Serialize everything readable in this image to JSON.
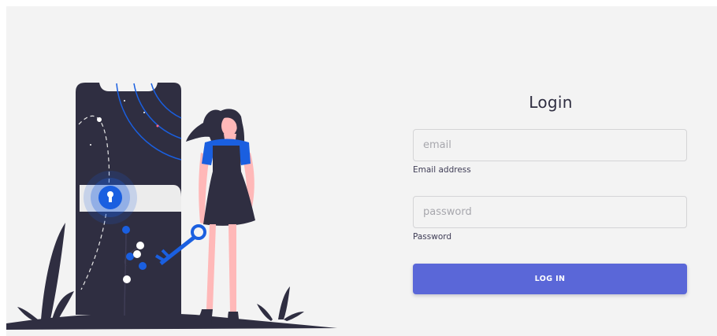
{
  "login": {
    "title": "Login",
    "email": {
      "placeholder": "email",
      "value": "",
      "help_text": "Email address"
    },
    "password": {
      "placeholder": "password",
      "value": "",
      "help_text": "Password"
    },
    "submit_label": "LOG IN"
  },
  "colors": {
    "accent": "#5a67d8",
    "illustration_blue": "#1a5fe0",
    "dark": "#2f2e41",
    "background": "#f3f3f3"
  }
}
